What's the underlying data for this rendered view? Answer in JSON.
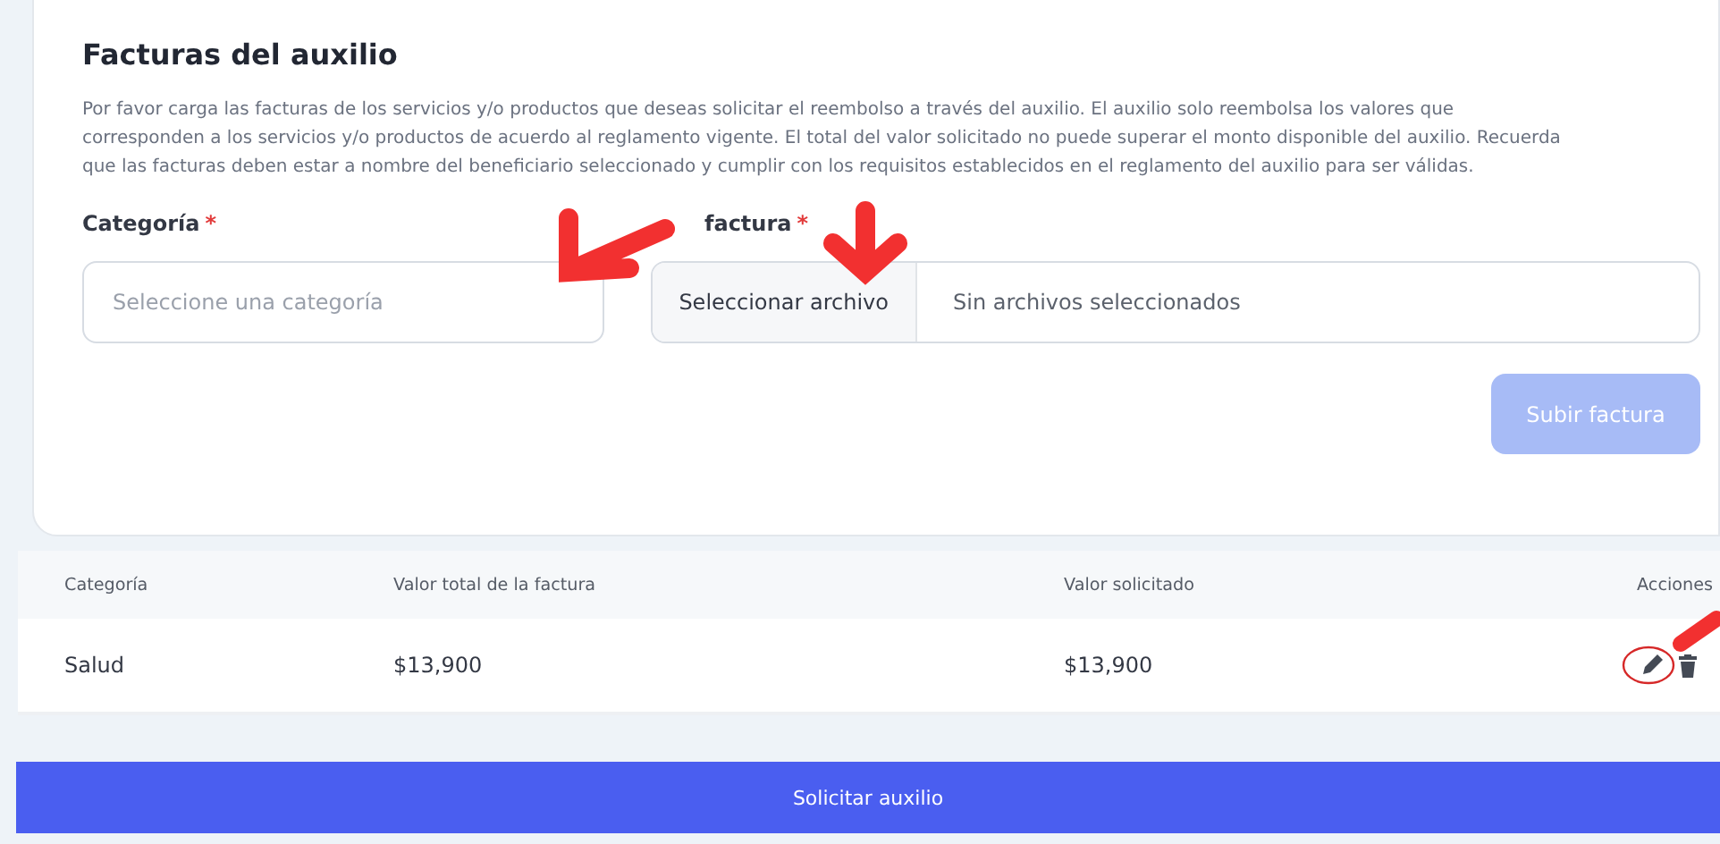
{
  "form": {
    "title": "Facturas del auxilio",
    "description": "Por favor carga las facturas de los servicios y/o productos que deseas solicitar el reembolso a través del auxilio. El auxilio solo reembolsa los valores que corresponden a los servicios y/o productos de acuerdo al reglamento vigente. El total del valor solicitado no puede superar el monto disponible del auxilio. Recuerda que las facturas deben estar a nombre del beneficiario seleccionado y cumplir con los requisitos establecidos en el reglamento del auxilio para ser válidas.",
    "category": {
      "label": "Categoría",
      "required": "*",
      "placeholder": "Seleccione una categoría"
    },
    "file": {
      "label": "factura",
      "required": "*",
      "button": "Seleccionar archivo",
      "status": "Sin archivos seleccionados"
    },
    "upload_button": {
      "label": "Subir factura",
      "disabled": true
    }
  },
  "table": {
    "columns": [
      "Categoría",
      "Valor total de la factura",
      "Valor solicitado",
      "Acciones"
    ],
    "rows": [
      {
        "cells": [
          "Salud",
          "$13,900",
          "$13,900"
        ]
      }
    ]
  },
  "submit_button": "Solicitar auxilio"
}
